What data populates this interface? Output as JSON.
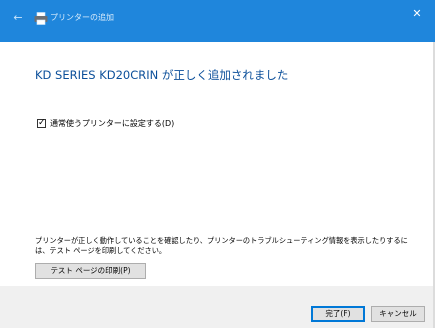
{
  "window": {
    "title": "プリンターの追加",
    "close_glyph": "✕",
    "back_glyph": "←"
  },
  "content": {
    "heading": "KD SERIES KD20CRIN が正しく追加されました",
    "default_printer_checkbox": {
      "label": "通常使うプリンターに設定する(D)",
      "checked": true
    },
    "info_text": "プリンターが正しく動作していることを確認したり、プリンターのトラブルシューティング情報を表示したりするには、テスト ページを印刷してください。",
    "test_page_button": "テスト ページの印刷(P)"
  },
  "footer": {
    "finish_button": "完了(F)",
    "cancel_button": "キャンセル"
  },
  "colors": {
    "titlebar": "#1f86dc",
    "heading": "#0b4f9a",
    "footer": "#f0f0f0",
    "accent_border": "#0078d7"
  }
}
